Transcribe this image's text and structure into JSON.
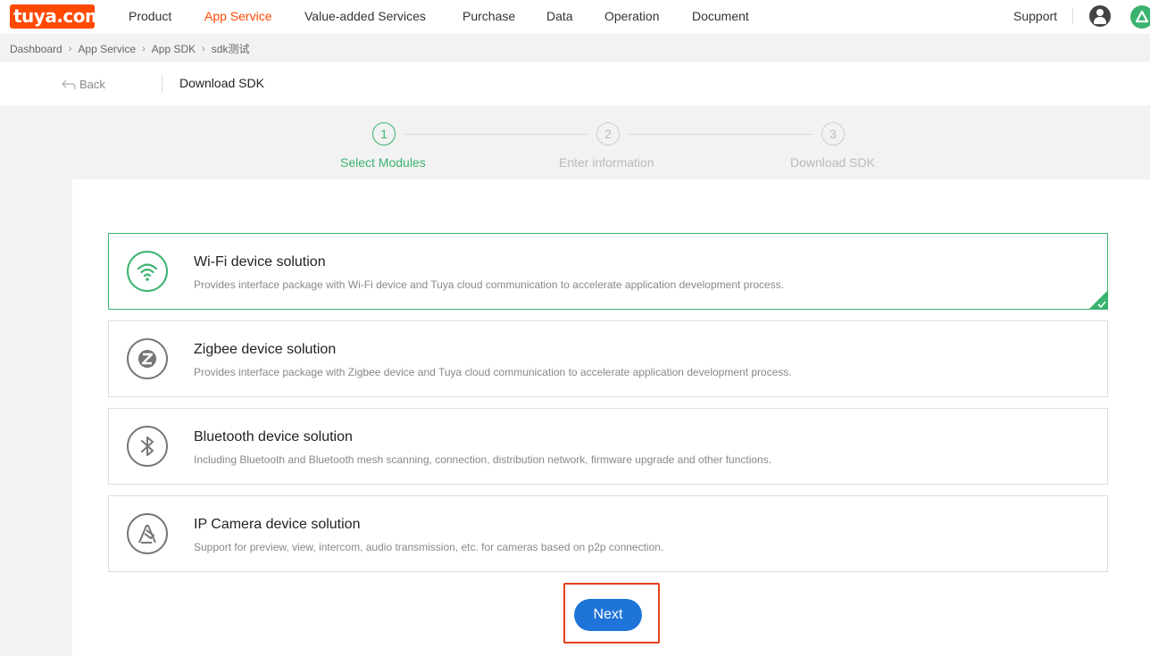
{
  "logo": {
    "text": "tuya.com"
  },
  "nav": {
    "items": [
      {
        "label": "Product",
        "active": false
      },
      {
        "label": "App Service",
        "active": true
      },
      {
        "label": "Value-added Services",
        "active": false
      },
      {
        "label": "Purchase",
        "active": false
      },
      {
        "label": "Data",
        "active": false
      },
      {
        "label": "Operation",
        "active": false
      },
      {
        "label": "Document",
        "active": false
      }
    ],
    "support": "Support"
  },
  "breadcrumb": [
    "Dashboard",
    "App Service",
    "App SDK",
    "sdk测试"
  ],
  "subheader": {
    "back_label": "Back",
    "title": "Download SDK"
  },
  "stepper": {
    "current": 1,
    "steps": [
      {
        "number": "1",
        "label": "Select Modules"
      },
      {
        "number": "2",
        "label": "Enter information"
      },
      {
        "number": "3",
        "label": "Download SDK"
      }
    ]
  },
  "solutions": [
    {
      "title": "Wi-Fi device solution",
      "description": "Provides interface package with Wi-Fi device and Tuya cloud communication to accelerate application development process.",
      "icon": "wifi-icon",
      "selected": true
    },
    {
      "title": "Zigbee device solution",
      "description": "Provides interface package with Zigbee device and Tuya cloud communication to accelerate application development process.",
      "icon": "zigbee-icon",
      "selected": false
    },
    {
      "title": "Bluetooth device solution",
      "description": "Including Bluetooth and Bluetooth mesh scanning, connection, distribution network, firmware upgrade and other functions.",
      "icon": "bluetooth-icon",
      "selected": false
    },
    {
      "title": "IP Camera device solution",
      "description": "Support for preview, view, intercom, audio transmission, etc. for cameras based on p2p connection.",
      "icon": "camera-icon",
      "selected": false
    }
  ],
  "next_button": {
    "label": "Next"
  },
  "colors": {
    "brand": "#ff4800",
    "accent_green": "#3ab36f",
    "primary_blue": "#1e74d8",
    "highlight_red": "#e8401e"
  }
}
